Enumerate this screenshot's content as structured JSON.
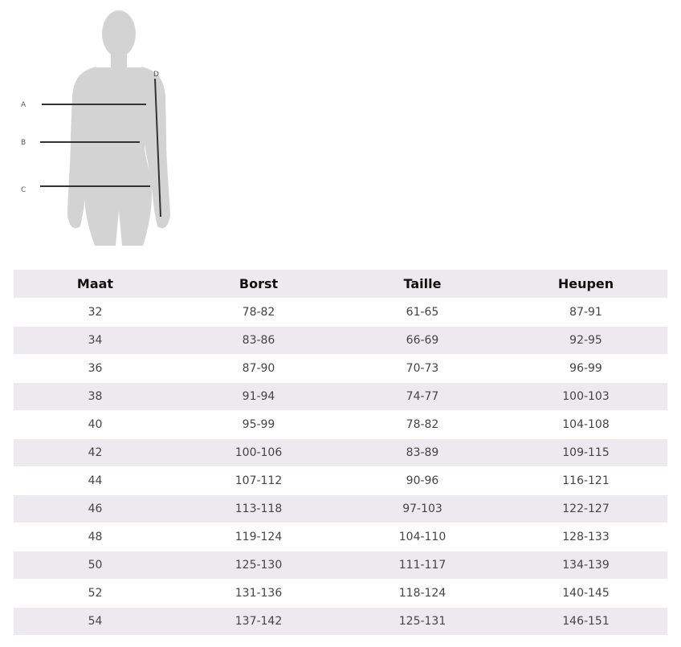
{
  "figure": {
    "labels": [
      "A",
      "B",
      "C",
      "D"
    ],
    "silhouette_color": "#d3d3d3",
    "line_color": "#333333"
  },
  "table": {
    "headers": [
      "Maat",
      "Borst",
      "Taille",
      "Heupen"
    ],
    "rows": [
      [
        "32",
        "78-82",
        "61-65",
        "87-91"
      ],
      [
        "34",
        "83-86",
        "66-69",
        "92-95"
      ],
      [
        "36",
        "87-90",
        "70-73",
        "96-99"
      ],
      [
        "38",
        "91-94",
        "74-77",
        "100-103"
      ],
      [
        "40",
        "95-99",
        "78-82",
        "104-108"
      ],
      [
        "42",
        "100-106",
        "83-89",
        "109-115"
      ],
      [
        "44",
        "107-112",
        "90-96",
        "116-121"
      ],
      [
        "46",
        "113-118",
        "97-103",
        "122-127"
      ],
      [
        "48",
        "119-124",
        "104-110",
        "128-133"
      ],
      [
        "50",
        "125-130",
        "111-117",
        "134-139"
      ],
      [
        "52",
        "131-136",
        "118-124",
        "140-145"
      ],
      [
        "54",
        "137-142",
        "125-131",
        "146-151"
      ]
    ],
    "stripe_color": "#eceaee"
  }
}
